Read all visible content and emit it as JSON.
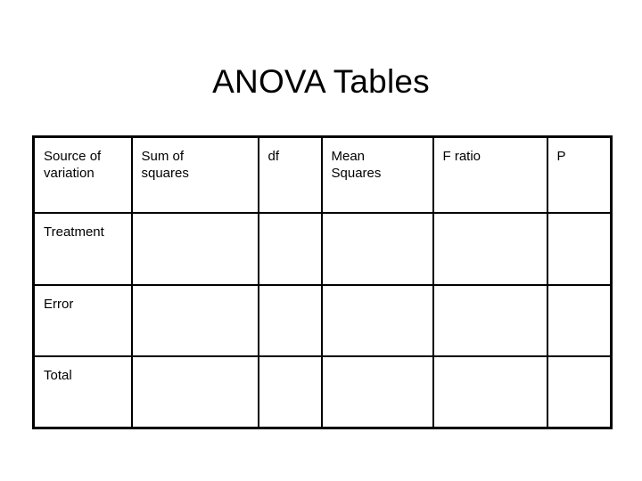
{
  "slide": {
    "title": "ANOVA Tables",
    "background_color": "#ffffff",
    "text_color": "#000000",
    "border_color": "#000000"
  },
  "table": {
    "name": "anova-table",
    "columns": [
      {
        "key": "source",
        "header": "Source of\nvariation"
      },
      {
        "key": "ss",
        "header": "Sum of\nsquares"
      },
      {
        "key": "df",
        "header": "df"
      },
      {
        "key": "ms",
        "header": "Mean\nSquares"
      },
      {
        "key": "f",
        "header": "F ratio"
      },
      {
        "key": "p",
        "header": "P"
      }
    ],
    "rows": [
      {
        "label": "Treatment",
        "ss": "",
        "df": "",
        "ms": "",
        "f": "",
        "p": ""
      },
      {
        "label": "Error",
        "ss": "",
        "df": "",
        "ms": "",
        "f": "",
        "p": ""
      },
      {
        "label": "Total",
        "ss": "",
        "df": "",
        "ms": "",
        "f": "",
        "p": ""
      }
    ]
  }
}
